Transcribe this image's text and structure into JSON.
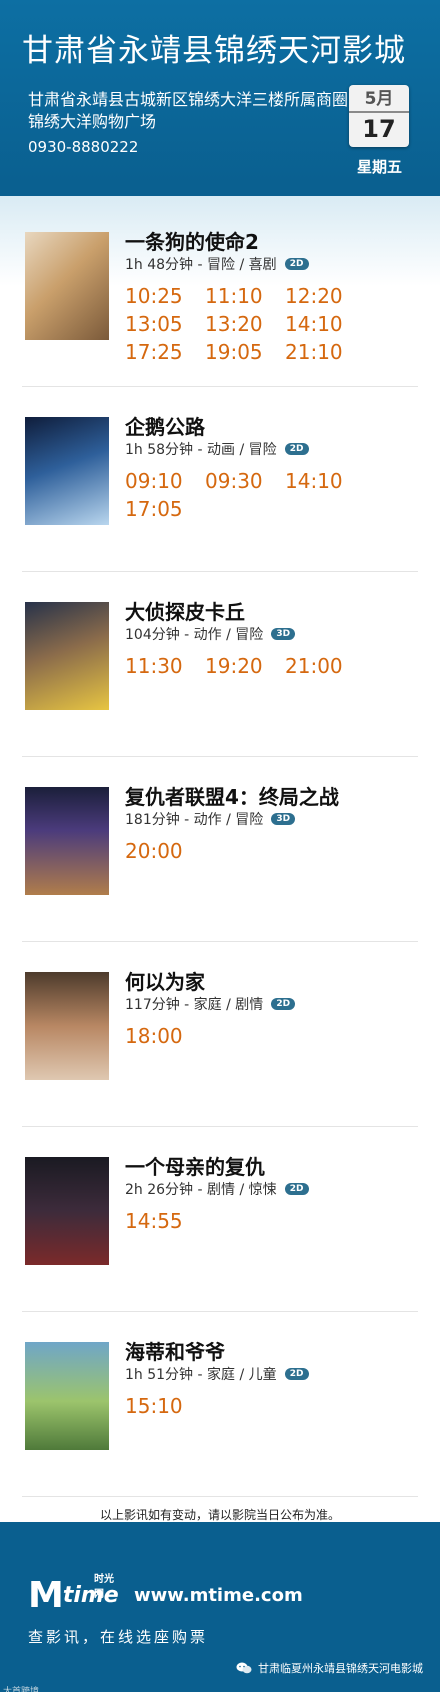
{
  "cinema": {
    "name": "甘肃省永靖县锦绣天河影城",
    "address": "甘肃省永靖县古城新区锦绣大洋三楼所属商圈锦绣大洋购物广场",
    "phone": "0930-8880222",
    "date": {
      "month": "5月",
      "day": "17",
      "weekday": "星期五"
    }
  },
  "movies": [
    {
      "title": "一条狗的使命2",
      "meta": "1h 48分钟 - 冒险 / 喜剧",
      "format": "2D",
      "times": [
        "10:25",
        "11:10",
        "12:20",
        "13:05",
        "13:20",
        "14:10",
        "17:25",
        "19:05",
        "21:10"
      ]
    },
    {
      "title": "企鹅公路",
      "meta": "1h 58分钟 - 动画 / 冒险",
      "format": "2D",
      "times": [
        "09:10",
        "09:30",
        "14:10",
        "17:05"
      ]
    },
    {
      "title": "大侦探皮卡丘",
      "meta": "104分钟 - 动作 / 冒险",
      "format": "3D",
      "times": [
        "11:30",
        "19:20",
        "21:00"
      ]
    },
    {
      "title": "复仇者联盟4：终局之战",
      "meta": "181分钟 - 动作 / 冒险",
      "format": "3D",
      "times": [
        "20:00"
      ]
    },
    {
      "title": "何以为家",
      "meta": "117分钟 - 家庭 / 剧情",
      "format": "2D",
      "times": [
        "18:00"
      ]
    },
    {
      "title": "一个母亲的复仇",
      "meta": "2h 26分钟 - 剧情 / 惊悚",
      "format": "2D",
      "times": [
        "14:55"
      ]
    },
    {
      "title": "海蒂和爷爷",
      "meta": "1h 51分钟 - 家庭 / 儿童",
      "format": "2D",
      "times": [
        "15:10"
      ]
    }
  ],
  "notice": "以上影讯如有变动，请以影院当日公布为准。",
  "footer": {
    "logo_m": "M",
    "logo_time": "time",
    "logo_cn": "时光网",
    "site": "www.mtime.com",
    "slogan": "查影讯，在线选座购票",
    "watermark": "甘肃临夏州永靖县锦绣天河电影城",
    "corner": "大首跨境"
  },
  "colors": {
    "header_bg": "#0a5f8f",
    "showtime": "#d5680f",
    "badge": "#2d6f8f"
  }
}
